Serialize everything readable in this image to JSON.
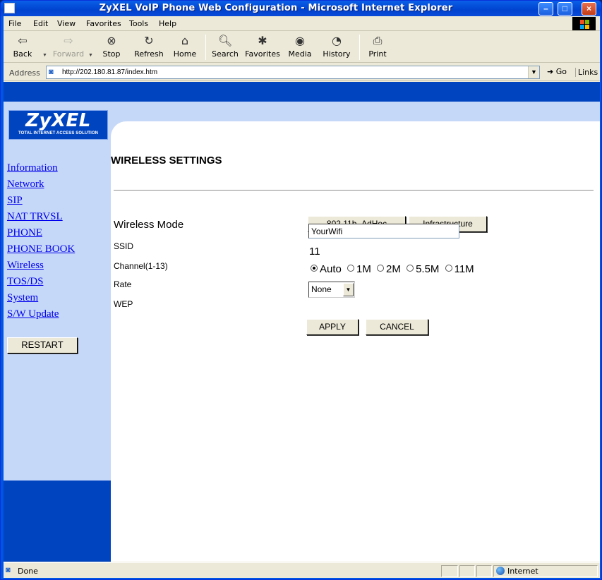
{
  "window": {
    "title": "ZyXEL VoIP Phone Web Configuration - Microsoft Internet Explorer"
  },
  "menu": [
    "File",
    "Edit",
    "View",
    "Favorites",
    "Tools",
    "Help"
  ],
  "toolbar": {
    "back": "Back",
    "forward": "Forward",
    "stop": "Stop",
    "refresh": "Refresh",
    "home": "Home",
    "search": "Search",
    "favorites": "Favorites",
    "media": "Media",
    "history": "History",
    "print": "Print"
  },
  "address": {
    "label": "Address",
    "url": "http://202.180.81.87/index.htm",
    "go": "Go",
    "links": "Links"
  },
  "logo": {
    "brand": "ZyXEL",
    "tagline": "TOTAL INTERNET ACCESS SOLUTION"
  },
  "sidebar": {
    "items": [
      "Information",
      "Network",
      "SIP",
      "NAT TRVSL",
      "PHONE",
      "PHONE BOOK",
      "Wireless",
      "TOS/DS",
      "System",
      "S/W Update"
    ],
    "restart": "RESTART"
  },
  "main": {
    "title": "WIRELESS SETTINGS",
    "wireless_mode_label": "Wireless Mode",
    "mode_adhoc": "802.11b_AdHoc",
    "mode_infra": "Infrastructure",
    "ssid_label": "SSID",
    "ssid_value": "YourWifi",
    "channel_label": "Channel(1-13)",
    "channel_value": "11",
    "rate_label": "Rate",
    "rates": [
      "Auto",
      "1M",
      "2M",
      "5.5M",
      "11M"
    ],
    "rate_selected": "Auto",
    "wep_label": "WEP",
    "wep_value": "None",
    "apply": "APPLY",
    "cancel": "CANCEL"
  },
  "status": {
    "text": "Done",
    "zone": "Internet"
  },
  "colors": {
    "nav_blue": "#0044c0",
    "sidebar_light": "#c6d8f8",
    "link": "#0000ee"
  }
}
